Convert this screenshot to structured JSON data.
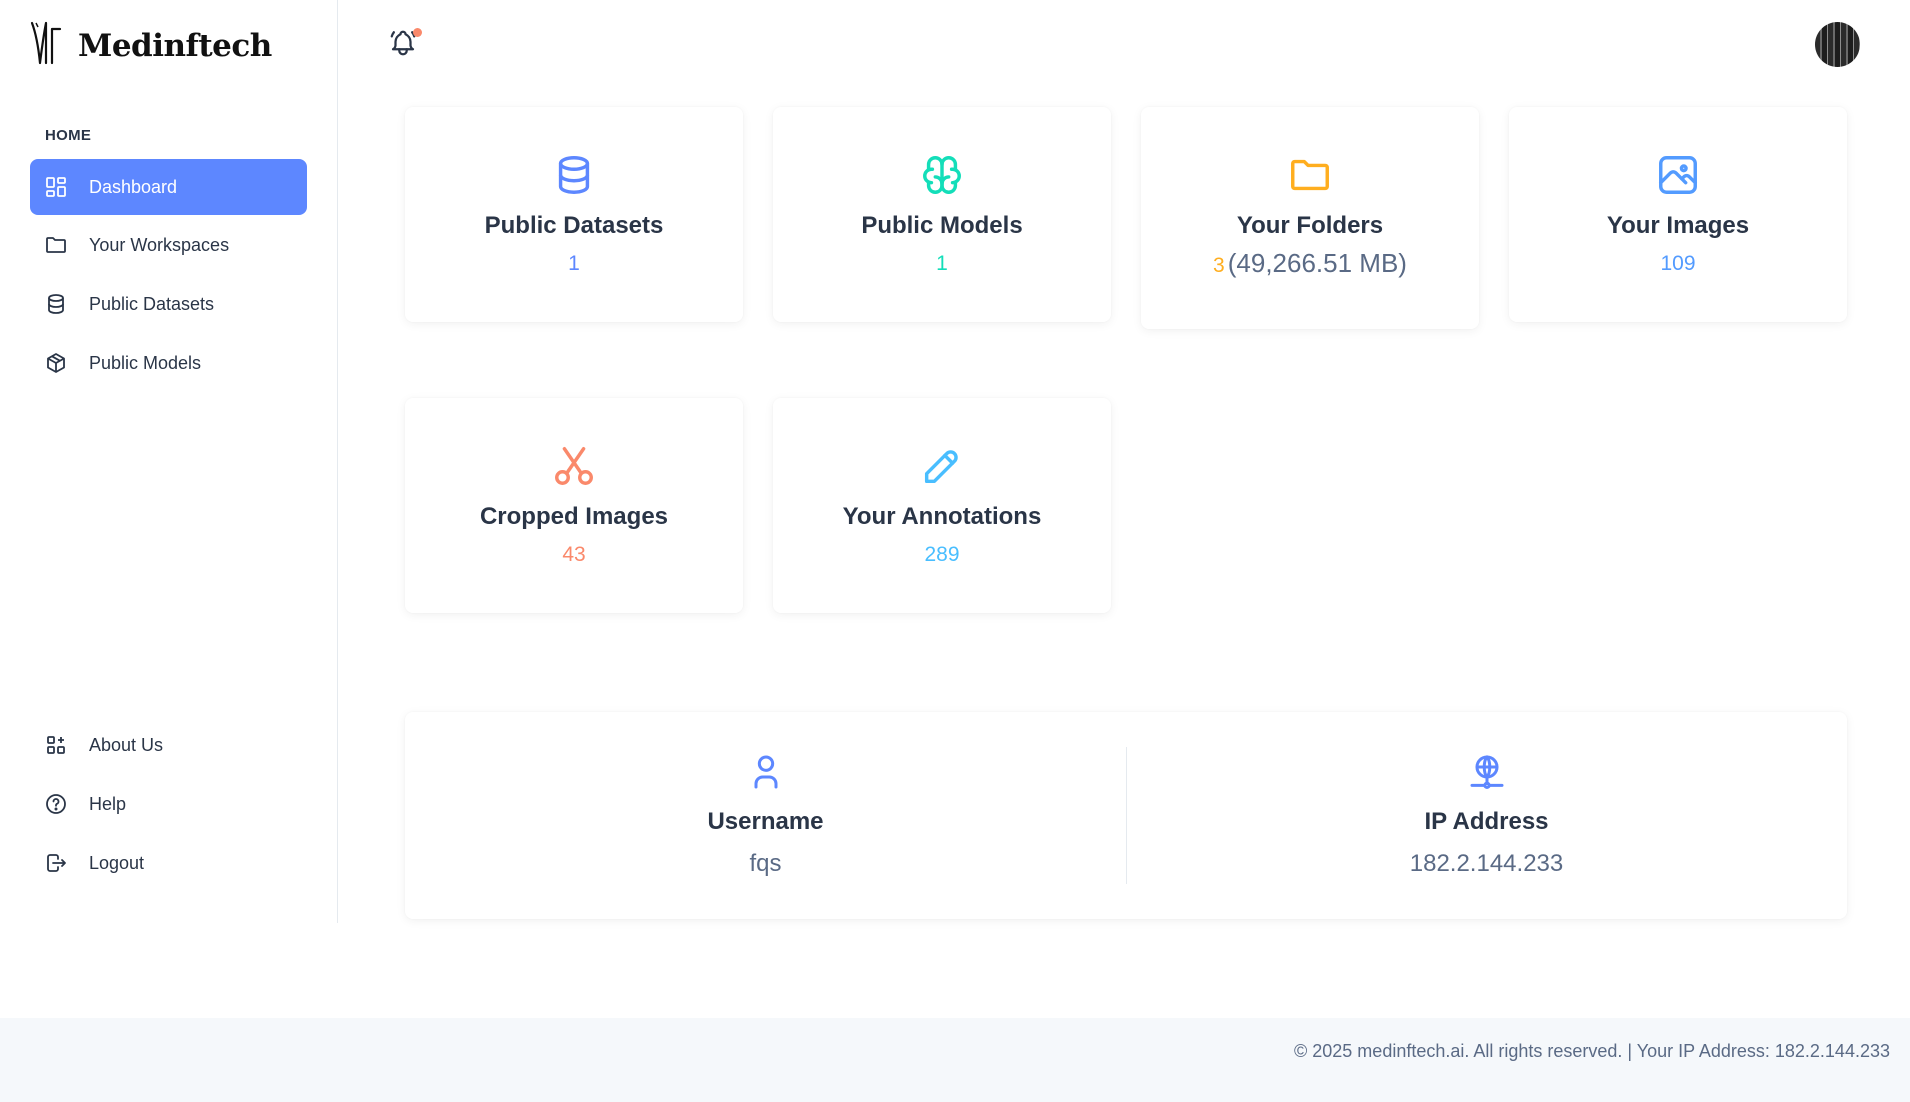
{
  "brand": {
    "name": "Medinftech"
  },
  "sidebar": {
    "heading": "HOME",
    "items": [
      {
        "label": "Dashboard",
        "icon": "dashboard-icon",
        "active": true
      },
      {
        "label": "Your Workspaces",
        "icon": "folder-icon"
      },
      {
        "label": "Public Datasets",
        "icon": "database-icon"
      },
      {
        "label": "Public Models",
        "icon": "cube-icon"
      }
    ],
    "bottom_items": [
      {
        "label": "About Us",
        "icon": "apps-icon"
      },
      {
        "label": "Help",
        "icon": "help-circle-icon"
      },
      {
        "label": "Logout",
        "icon": "logout-icon"
      }
    ]
  },
  "header": {
    "notification_icon": "bell-icon",
    "has_unread": true
  },
  "stats": [
    {
      "title": "Public Datasets",
      "value": "1",
      "icon": "database-icon",
      "color": "#5d87ff"
    },
    {
      "title": "Public Models",
      "value": "1",
      "icon": "brain-icon",
      "color": "#13deb9"
    },
    {
      "title": "Your Folders",
      "value": "3",
      "sub": "(49,266.51 MB)",
      "icon": "folder-icon",
      "color": "#ffae1f"
    },
    {
      "title": "Your Images",
      "value": "109",
      "icon": "photo-icon",
      "color": "#539bff"
    },
    {
      "title": "Cropped Images",
      "value": "43",
      "icon": "scissors-icon",
      "color": "#fa896b"
    },
    {
      "title": "Your Annotations",
      "value": "289",
      "icon": "pencil-icon",
      "color": "#49beff"
    }
  ],
  "info": {
    "username_label": "Username",
    "username": "fqs",
    "ip_label": "IP Address",
    "ip": "182.2.144.233"
  },
  "footer": {
    "text": "© 2025 medinftech.ai. All rights reserved. | Your IP Address: 182.2.144.233"
  }
}
